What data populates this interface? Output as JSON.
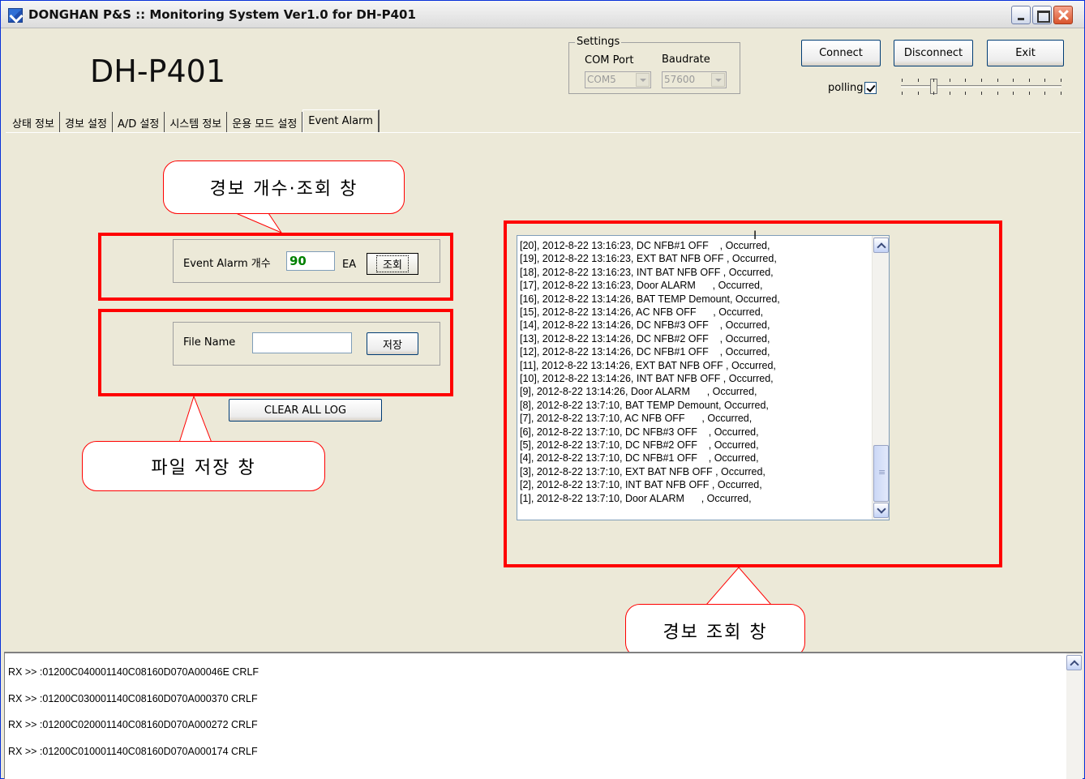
{
  "window": {
    "title": "DONGHAN P&S :: Monitoring System Ver1.0 for DH-P401"
  },
  "header": {
    "model": "DH-P401"
  },
  "settings": {
    "legend": "Settings",
    "com_port_label": "COM Port",
    "baudrate_label": "Baudrate",
    "com_port_value": "COM5",
    "baudrate_value": "57600"
  },
  "toolbar": {
    "connect_label": "Connect",
    "disconnect_label": "Disconnect",
    "exit_label": "Exit",
    "polling_label": "polling",
    "polling_checked": true
  },
  "tabs": [
    {
      "label": "상태 정보"
    },
    {
      "label": "경보 설정"
    },
    {
      "label": "A/D 설정"
    },
    {
      "label": "시스템 정보"
    },
    {
      "label": "운용 모드 설정"
    },
    {
      "label": "Event Alarm"
    }
  ],
  "alarm_count": {
    "label": "Event Alarm 개수",
    "value": "90",
    "unit": "EA",
    "query_button": "조회"
  },
  "file_save": {
    "label": "File Name",
    "value": "",
    "save_button": "저장"
  },
  "clear_button": "CLEAR ALL LOG",
  "callouts": {
    "count_window": "경보 개수·조회 창",
    "file_window": "파일 저장 창",
    "query_window": "경보 조회 창"
  },
  "event_log": [
    "[20], 2012-8-22 13:16:23, DC NFB#1 OFF    , Occurred,",
    "[19], 2012-8-22 13:16:23, EXT BAT NFB OFF , Occurred,",
    "[18], 2012-8-22 13:16:23, INT BAT NFB OFF , Occurred,",
    "[17], 2012-8-22 13:16:23, Door ALARM      , Occurred,",
    "[16], 2012-8-22 13:14:26, BAT TEMP Demount, Occurred,",
    "[15], 2012-8-22 13:14:26, AC NFB OFF      , Occurred,",
    "[14], 2012-8-22 13:14:26, DC NFB#3 OFF    , Occurred,",
    "[13], 2012-8-22 13:14:26, DC NFB#2 OFF    , Occurred,",
    "[12], 2012-8-22 13:14:26, DC NFB#1 OFF    , Occurred,",
    "[11], 2012-8-22 13:14:26, EXT BAT NFB OFF , Occurred,",
    "[10], 2012-8-22 13:14:26, INT BAT NFB OFF , Occurred,",
    "[9], 2012-8-22 13:14:26, Door ALARM      , Occurred,",
    "[8], 2012-8-22 13:7:10, BAT TEMP Demount, Occurred,",
    "[7], 2012-8-22 13:7:10, AC NFB OFF      , Occurred,",
    "[6], 2012-8-22 13:7:10, DC NFB#3 OFF    , Occurred,",
    "[5], 2012-8-22 13:7:10, DC NFB#2 OFF    , Occurred,",
    "[4], 2012-8-22 13:7:10, DC NFB#1 OFF    , Occurred,",
    "[3], 2012-8-22 13:7:10, EXT BAT NFB OFF , Occurred,",
    "[2], 2012-8-22 13:7:10, INT BAT NFB OFF , Occurred,",
    "[1], 2012-8-22 13:7:10, Door ALARM      , Occurred,"
  ],
  "rx_log": [
    "RX >> :01200C040001140C08160D070A00046E CRLF",
    "RX >> :01200C030001140C08160D070A000370 CRLF",
    "RX >> :01200C020001140C08160D070A000272 CRLF",
    "RX >> :01200C010001140C08160D070A000174 CRLF"
  ],
  "colors": {
    "highlight_red": "#ff0000",
    "count_green": "#008000",
    "window_bg": "#ece9d8"
  }
}
